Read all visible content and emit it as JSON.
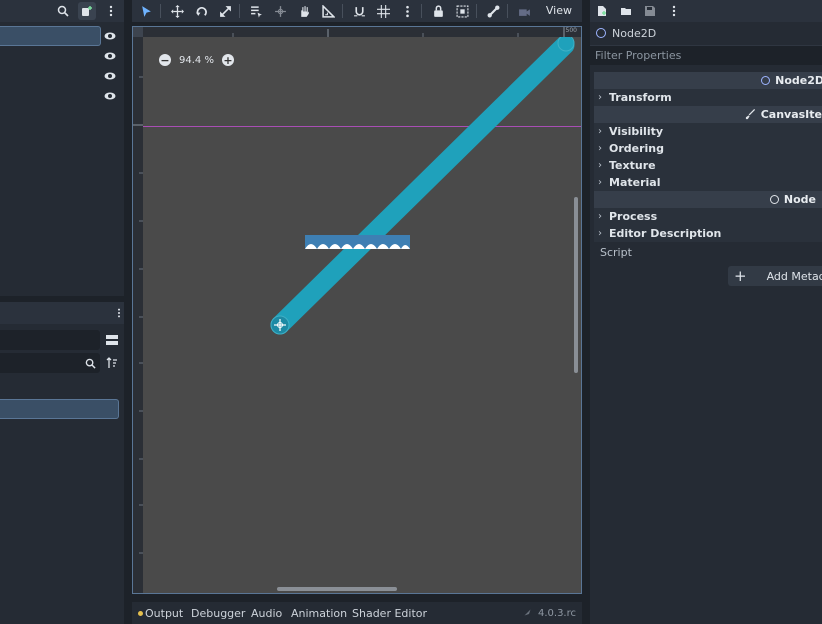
{
  "colors": {
    "accent": "#6fb3ff",
    "selection": "#3a4f66",
    "guide": "#c04fd0",
    "line_stroke": "#1a9ab5",
    "output_dot": "#e5c04e"
  },
  "scene_dock": {
    "rows": [
      {
        "icon": "eye-icon",
        "selected": true
      },
      {
        "icon": "eye-icon"
      },
      {
        "icon": "eye-icon"
      },
      {
        "icon": "eye-icon"
      }
    ]
  },
  "toolbar": {
    "view_label": "View",
    "tools": [
      "select-tool-icon",
      "move-tool-icon",
      "rotate-tool-icon",
      "scale-tool-icon",
      "list-select-icon",
      "pivot-icon",
      "pan-icon",
      "ruler-icon",
      "smart-snap-icon",
      "grid-snap-icon",
      "more-icon",
      "lock-icon",
      "group-icon",
      "skeleton-icon",
      "override-camera-icon"
    ]
  },
  "viewport": {
    "zoom_label": "94.4 %",
    "ruler_label": "500"
  },
  "bottom_panel": {
    "tabs": [
      "Output",
      "Debugger",
      "Audio",
      "Animation",
      "Shader Editor"
    ],
    "version": "4.0.3.rc"
  },
  "inspector": {
    "object_name": "Node2D",
    "filter_placeholder": "Filter Properties",
    "categories": {
      "node2d": "Node2D",
      "canvas_item": "CanvasIte",
      "node": "Node"
    },
    "sections": {
      "transform": "Transform",
      "visibility": "Visibility",
      "ordering": "Ordering",
      "texture": "Texture",
      "material": "Material",
      "process": "Process",
      "editor_description": "Editor Description"
    },
    "script_label": "Script",
    "add_metadata_label": "Add Metada"
  }
}
